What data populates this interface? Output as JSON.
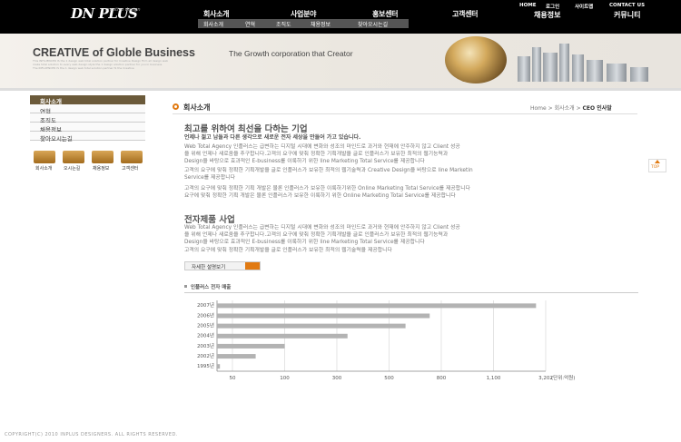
{
  "header": {
    "logo": "DN PLUS",
    "logo_sub": "creative design",
    "gnb": [
      "회사소개",
      "사업분야",
      "홍보센터",
      "고객센터",
      "채용정보",
      "커뮤니티"
    ],
    "sub_menu": [
      "회사소개",
      "연혁",
      "조직도",
      "채용정보",
      "찾아오시는길"
    ],
    "util": [
      "HOME",
      "로그인",
      "사이트맵",
      "CONTACT US"
    ]
  },
  "visual": {
    "title": "CREATIVE of Globle Business",
    "subtitle": "The Growth corporation that Creator",
    "tiny_lines": [
      "This INFLUENCER IS the 1 design web total solution partner for Creative Design Firm all design web",
      "make total solution to every web design style the 1 design solution partner for you in business",
      "The INFLUENCER IS the 1 design web total solution partner IS the Creative"
    ]
  },
  "lnb": {
    "head": "회사소개",
    "items": [
      "연혁",
      "조직도",
      "채용정보",
      "찾아오시는길"
    ],
    "quick": [
      "회사소개",
      "오시는길",
      "채용정보",
      "고객센터"
    ]
  },
  "content": {
    "page_title": "회사소개",
    "breadcrumb_home": "Home",
    "breadcrumb_mid": "회사소개",
    "breadcrumb_current": "CEO 인사말",
    "section1_title": "최고를 위하여 최선을 다하는 기업",
    "section1_lead": "언제나 젊고 남들과 다른 생각으로 새로운 전자 세상을 만들어 가고 있습니다.",
    "section1_paras": [
      [
        "Web Total Agency 인플러스는 급변하는 디지털 시대에 변화와 성조의 마인드로 과거와 현재에 안주하지 않고 Client 성공",
        "을 위해 언제나 새로움을 추구합니다.고객의 요구에 맞춰 정확한 기획개발을 글로 인플러스가 보유한 최적의 웹기능력과",
        "Design을 바탕으로 효과적인 E-business를 이룩하기 위한 line Marketing Total Service를 제공합니다"
      ],
      [
        "고객의 요구에 맞춰 정확한 기획개발을 글로 인플러스가 보유한 최적의 웹기술력과 Creative Design을 바탕으로 line Marketin",
        "Service를 제공합니다"
      ],
      [
        "고객의 요구에 맞춰 정확한 기획 개발은 물론 인플러스가 보유한  이룩하기위한 Online Marketing Total Service를 제공합니다",
        "요구에 맞춰 정확한 기획 개발은 물론  인플러스가 보유한  이룩하기 위한 Online Marketing Total Service를 제공합니다"
      ]
    ],
    "section2_title": "전자제품 사업",
    "section2_paras": [
      [
        "Web Total Agency 인플러스는 급변하는 디지털 시대에 변화와 성조의 마인드로 과거와 현재에 안주하지 않고 Client 성공",
        "을 위해 언제나 새로움을 추구합니다.고객의 요구에 맞춰 정확한 기획개발을 글로 인플러스가 보유한 최적의 웹기능력과",
        "Design을 바탕으로 효과적인 E-business를 이룩하기 위한 line Marketing Total Service를 제공합니다"
      ],
      [
        "고객의 요구에 맞춰 정확한 기획개발을 글로 인플러스가 보유한 최적의 웹기술력을 제공합니다"
      ]
    ],
    "more_button": "자세한 설명보기",
    "chart_title": "인플러스 전자 매출"
  },
  "chart_data": {
    "type": "bar",
    "orientation": "horizontal",
    "categories": [
      "2007년",
      "2006년",
      "2005년",
      "2004년",
      "2003년",
      "2002년",
      "1995년"
    ],
    "values": [
      1650,
      1100,
      975,
      675,
      350,
      200,
      15
    ],
    "x_ticks": [
      "50",
      "100",
      "300",
      "500",
      "800",
      "1,100",
      "3,202"
    ],
    "x_unit": "(단위:억원)",
    "grid": true,
    "bar_color": "#b3b3b3"
  },
  "footer": "COPYRIGHT(C) 2010 INPLUS DESIGNERS. ALL RIGHTS RESERVED.",
  "top_button": "TOP"
}
